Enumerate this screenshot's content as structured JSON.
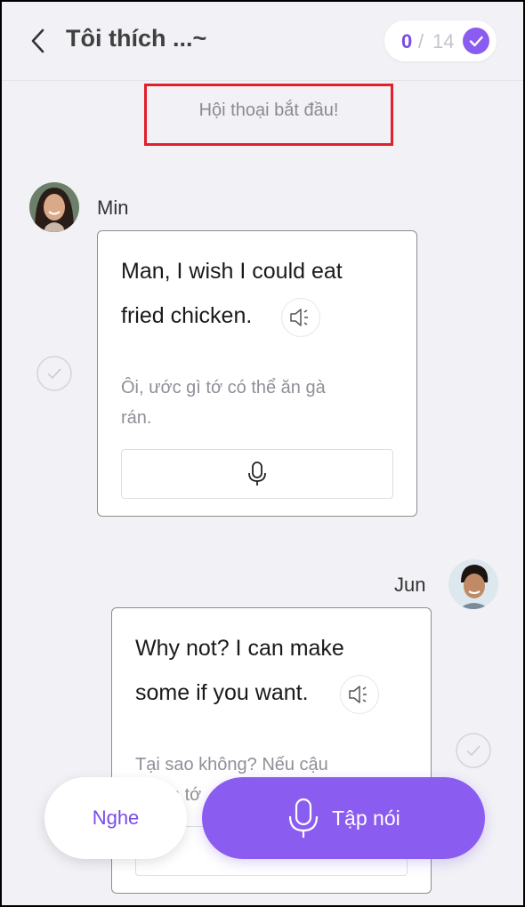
{
  "header": {
    "title": "Tôi thích ...~",
    "progress_current": "0",
    "progress_sep": "/",
    "progress_total": "14"
  },
  "conversation": {
    "start_notice": "Hội thoại bắt đầu!",
    "messages": [
      {
        "speaker": "Min",
        "english_line1": "Man, I wish I could eat",
        "english_line2": "fried chicken.",
        "vietnamese_line1": "Ôi, ước gì tớ có thể ăn gà",
        "vietnamese_line2": "rán."
      },
      {
        "speaker": "Jun",
        "english_line1": "Why not? I can make",
        "english_line2": "some if you want.",
        "vietnamese_line1": "Tại sao không? Nếu cậu",
        "vietnamese_line2": "muốn tớ"
      }
    ]
  },
  "actions": {
    "listen_label": "Nghe",
    "speak_label": "Tập nói"
  },
  "colors": {
    "accent": "#8b5cf0",
    "background": "#f1f1f6",
    "highlight_box": "#e0202a"
  }
}
